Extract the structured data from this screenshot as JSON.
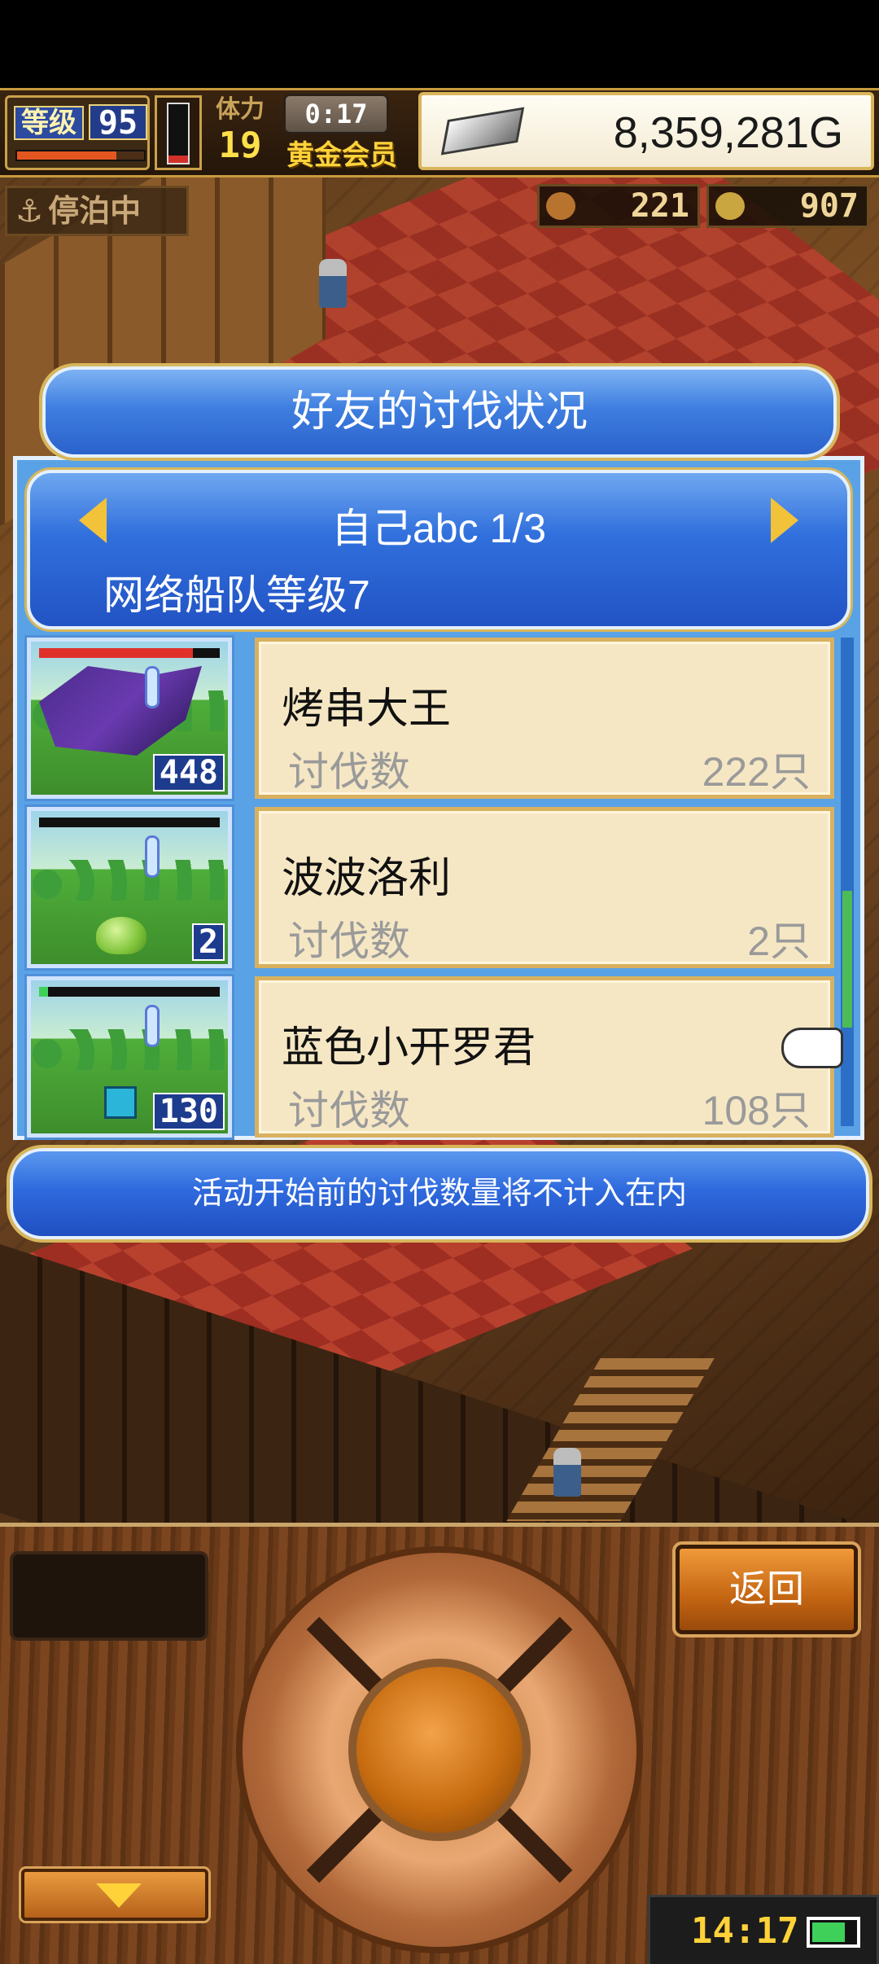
{
  "hud": {
    "level_label": "等级",
    "level": "95",
    "level_xp_fraction": 0.78,
    "stamina_label": "体力",
    "stamina": "19",
    "stamina_fraction": 0.12,
    "timer": "0:17",
    "membership": "黄金会员",
    "gold": "8,359,281G",
    "docked_status": "停泊中",
    "resource_a": "221",
    "resource_b": "907"
  },
  "dialog": {
    "title": "好友的讨伐状况",
    "friend_name": "自己abc 1/3",
    "fleet_level": "网络船队等级7",
    "notice": "活动开始前的讨伐数量将不计入在内"
  },
  "entries": [
    {
      "name": "烤串大王",
      "kill_label": "讨伐数",
      "kill_count": "222只",
      "thumb_count": "448",
      "monster_icon": "dark-warrior-monster",
      "hp_fraction": 0.85,
      "hp_color": "#e0302a"
    },
    {
      "name": "波波洛利",
      "kill_label": "讨伐数",
      "kill_count": "2只",
      "thumb_count": "2",
      "monster_icon": "green-slime-monster",
      "hp_fraction": 0.0,
      "hp_color": "#3fd05a"
    },
    {
      "name": "蓝色小开罗君",
      "kill_label": "讨伐数",
      "kill_count": "108只",
      "thumb_count": "130",
      "monster_icon": "blue-kairo-monster",
      "hp_fraction": 0.05,
      "hp_color": "#3fd05a"
    }
  ],
  "scroll": {
    "position_fraction": 0.72,
    "thumb_fraction": 0.28
  },
  "controls": {
    "back_label": "返回",
    "clock": "14:17",
    "battery_fraction": 0.8
  },
  "colors": {
    "dialog_blue": "#3170dd",
    "entry_bg": "#f6e7c4",
    "gold_trim": "#d7b65b",
    "back_button": "#c46512"
  }
}
